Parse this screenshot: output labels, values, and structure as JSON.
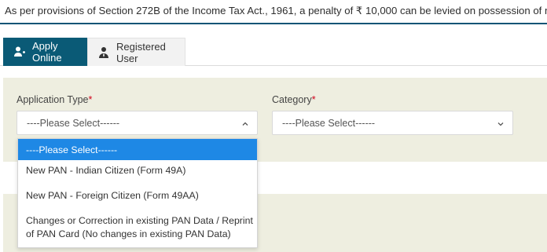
{
  "notice": {
    "text": "As per provisions of Section 272B of the Income Tax Act., 1961, a penalty of ₹ 10,000 can be levied on possession of more than one PAN."
  },
  "tabs": [
    {
      "label": "Apply Online",
      "icon": "person-add-icon",
      "active": true
    },
    {
      "label": "Registered User",
      "icon": "user-tie-icon",
      "active": false
    }
  ],
  "form": {
    "application_type": {
      "label": "Application Type",
      "required_mark": "*",
      "selected": "----Please Select------",
      "expanded": true,
      "options": [
        "----Please Select------",
        "New PAN - Indian Citizen (Form 49A)",
        "New PAN - Foreign Citizen (Form 49AA)",
        "Changes or Correction in existing PAN Data / Reprint of PAN Card (No changes in existing PAN Data)"
      ]
    },
    "category": {
      "label": "Category",
      "required_mark": "*",
      "selected": "----Please Select------",
      "expanded": false
    }
  },
  "colors": {
    "tab_active_bg": "#0a5a76",
    "highlight_option_bg": "#1e88e5",
    "required_mark": "#d0021b",
    "form_band_bg": "#eeeee0"
  }
}
